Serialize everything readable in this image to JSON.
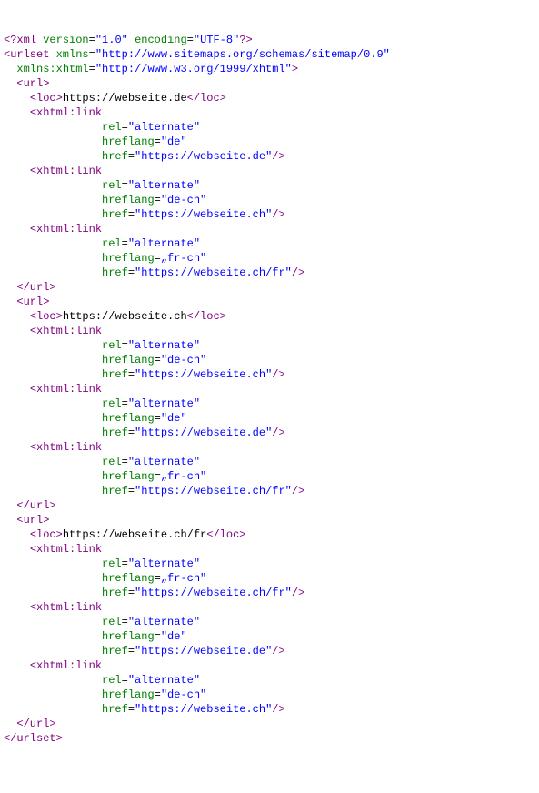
{
  "xml_decl": {
    "open": "<?xml ",
    "version_attr": "version",
    "version_val": "\"1.0\"",
    "encoding_attr": "encoding",
    "encoding_val": "\"UTF-8\"",
    "close": "?>"
  },
  "urlset": {
    "open": "<urlset ",
    "xmlns_attr": "xmlns",
    "xmlns_val": "\"http://www.sitemaps.org/schemas/sitemap/0.9\"",
    "xmlns_xhtml_attr": "xmlns:xhtml",
    "xmlns_xhtml_val": "\"http://www.w3.org/1999/xhtml\"",
    "close_open": ">",
    "close": "</urlset>"
  },
  "t": {
    "url_open": "<url>",
    "url_close": "</url>",
    "loc_open": "<loc>",
    "loc_close": "</loc>",
    "link_tag": "<xhtml:link",
    "rel_attr": "rel",
    "rel_val": "\"alternate\"",
    "hreflang_attr": "hreflang",
    "href_attr": "href",
    "selfclose": "/>"
  },
  "urls": [
    {
      "loc": "https://webseite.de",
      "links": [
        {
          "hreflang": "\"de\"",
          "href": "\"https://webseite.de\""
        },
        {
          "hreflang": "\"de-ch\"",
          "href": "\"https://webseite.ch\""
        },
        {
          "hreflang": "„fr-ch\"",
          "href": "\"https://webseite.ch/fr\""
        }
      ]
    },
    {
      "loc": "https://webseite.ch",
      "links": [
        {
          "hreflang": "\"de-ch\"",
          "href": "\"https://webseite.ch\""
        },
        {
          "hreflang": "\"de\"",
          "href": "\"https://webseite.de\""
        },
        {
          "hreflang": "„fr-ch\"",
          "href": "\"https://webseite.ch/fr\""
        }
      ]
    },
    {
      "loc": "https://webseite.ch/fr",
      "links": [
        {
          "hreflang": "„fr-ch\"",
          "href": "\"https://webseite.ch/fr\""
        },
        {
          "hreflang": "\"de\"",
          "href": "\"https://webseite.de\""
        },
        {
          "hreflang": "\"de-ch\"",
          "href": "\"https://webseite.ch\""
        }
      ]
    }
  ]
}
